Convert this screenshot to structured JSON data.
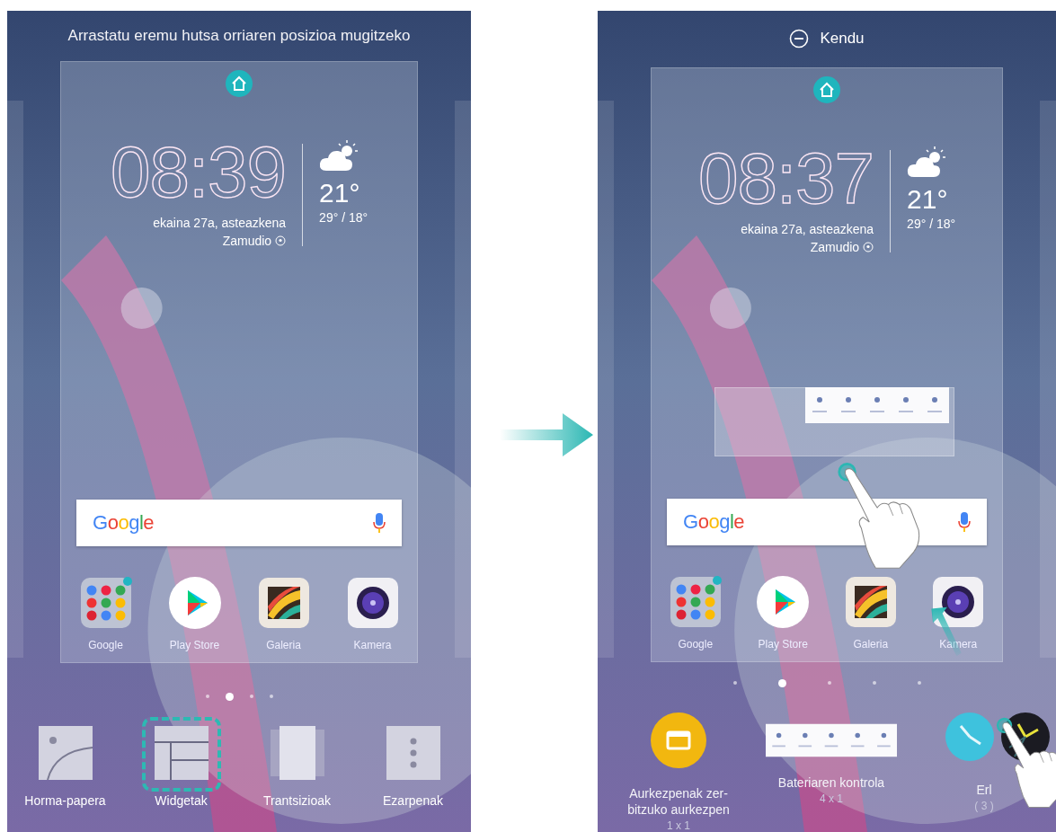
{
  "screens": [
    {
      "header": {
        "kind": "hint",
        "text": "Arrastatu eremu hutsa orriaren posizioa mugitzeko"
      },
      "card": {
        "clock": {
          "time": "08:39",
          "date": "ekaina 27a, asteazkena",
          "location": "Zamudio"
        },
        "weather": {
          "temperature": "21°",
          "range": "29° / 18°"
        },
        "search": {
          "logo": "Google"
        },
        "apps": [
          {
            "kind": "folder",
            "label": "Google"
          },
          {
            "kind": "play",
            "label": "Play Store"
          },
          {
            "kind": "gallery",
            "label": "Galeria"
          },
          {
            "kind": "camera",
            "label": "Kamera"
          }
        ]
      },
      "page_dots": [
        {
          "selected": false
        },
        {
          "selected": true
        },
        {
          "selected": false
        },
        {
          "selected": false
        }
      ],
      "bottom": {
        "kind": "menu",
        "items": [
          {
            "kind": "wallpaper",
            "label": "Horma-papera",
            "selected": false
          },
          {
            "kind": "widgets",
            "label": "Widgetak",
            "selected": true
          },
          {
            "kind": "transitions",
            "label": "Trantsizioak",
            "selected": false
          },
          {
            "kind": "settings",
            "label": "Ezarpenak",
            "selected": false
          }
        ]
      }
    },
    {
      "header": {
        "kind": "action",
        "text": "Kendu"
      },
      "card": {
        "clock": {
          "time": "08:37",
          "date": "ekaina 27a, asteazkena",
          "location": "Zamudio"
        },
        "weather": {
          "temperature": "21°",
          "range": "29° / 18°"
        },
        "search": {
          "logo": "Google"
        },
        "apps": [
          {
            "kind": "folder",
            "label": "Google"
          },
          {
            "kind": "play",
            "label": "Play Store"
          },
          {
            "kind": "gallery",
            "label": "Galeria"
          },
          {
            "kind": "camera",
            "label": "Kamera"
          }
        ],
        "dragged_widget": {
          "kind": "battery",
          "touched": true
        }
      },
      "page_dots": [
        {
          "selected": false
        },
        {
          "selected": true
        },
        {
          "selected": false
        },
        {
          "selected": false
        },
        {
          "selected": false
        }
      ],
      "bottom": {
        "kind": "widgets",
        "items": [
          {
            "kind": "slideshow",
            "label": "Aurkezpenak zer-bitzuko aurkezpen",
            "size": "1 x 1",
            "touched": false
          },
          {
            "kind": "battery",
            "label": "Bateriaren kontrola",
            "size": "4 x 1",
            "touched": false
          },
          {
            "kind": "clocks",
            "label": "Erl",
            "size": "( 3 )",
            "touched": true
          }
        ]
      }
    }
  ]
}
